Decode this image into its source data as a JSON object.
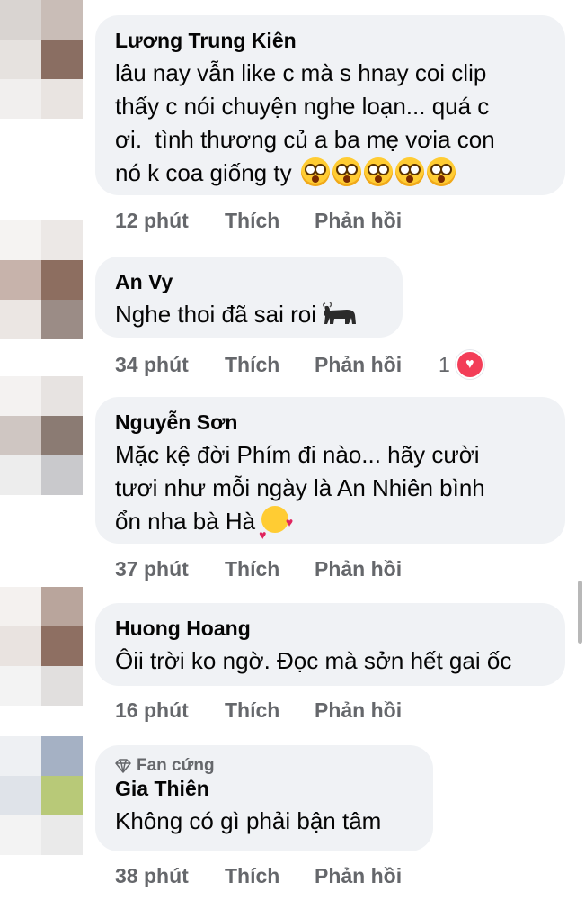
{
  "comments": [
    {
      "author": "Lương Trung Kiên",
      "text": "lâu nay vẫn like c mà s hnay coi clip\nthấy c nói chuyện nghe loạn... quá c\nơi.  tình thương củ a ba mẹ vơia con\nnó k coa giống ty",
      "emoji": "dizzy-face x5",
      "time": "12 phút",
      "like": "Thích",
      "reply": "Phản hồi"
    },
    {
      "author": "An Vy",
      "text": "Nghe thoi đã sai roi",
      "emoji": "water-buffalo",
      "time": "34 phút",
      "like": "Thích",
      "reply": "Phản hồi",
      "reaction_count": "1"
    },
    {
      "author": "Nguyễn Sơn",
      "text": "Mặc kệ đời Phím đi nào... hãy cười\ntươi như mỗi ngày là An Nhiên bình\nổn nha bà Hà",
      "emoji": "smiling-face-with-hearts",
      "time": "37 phút",
      "like": "Thích",
      "reply": "Phản hồi"
    },
    {
      "author": "Huong Hoang",
      "text": "Ôii trời ko ngờ. Đọc mà sởn hết gai ốc",
      "time": "16 phút",
      "like": "Thích",
      "reply": "Phản hồi"
    },
    {
      "badge": "Fan cứng",
      "author": "Gia Thiên",
      "text": "Không có gì phải bận tâm",
      "time": "38 phút",
      "like": "Thích",
      "reply": "Phản hồi"
    }
  ],
  "colors": {
    "bubble": "#f0f2f5",
    "meta": "#65676b",
    "heart": "#f33e58"
  }
}
